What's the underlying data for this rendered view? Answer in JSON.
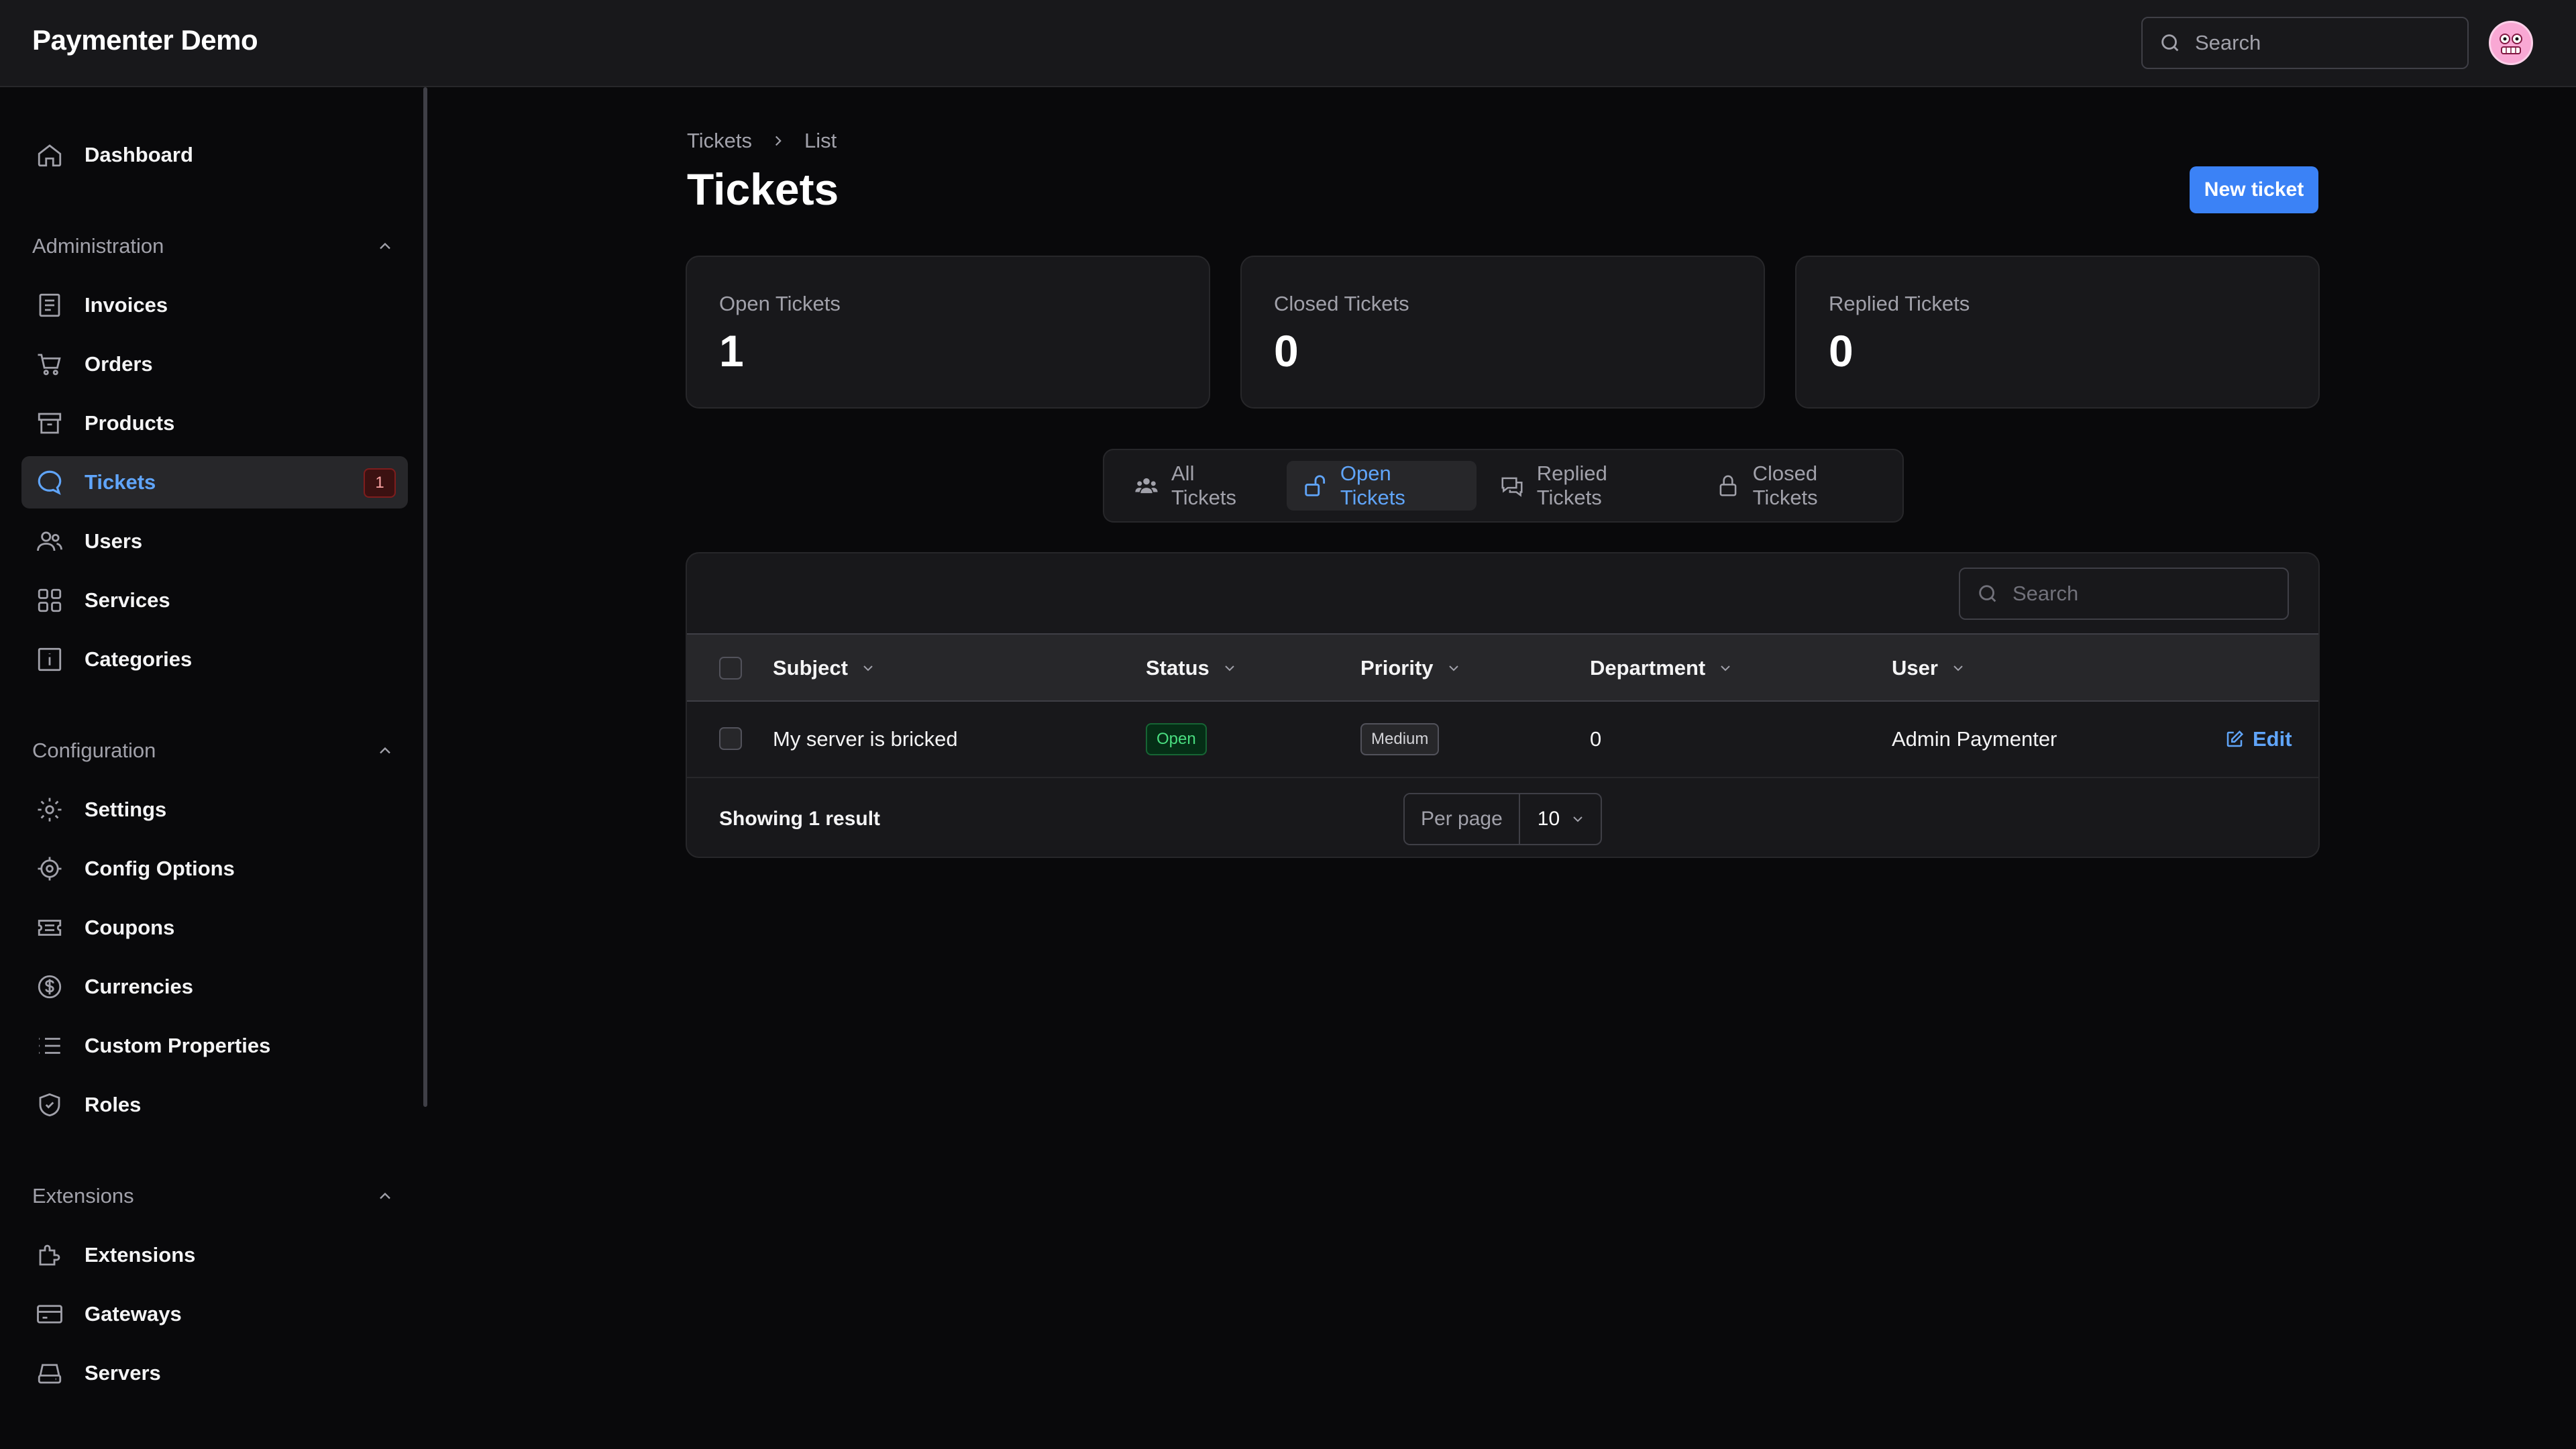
{
  "app": {
    "title": "Paymenter Demo"
  },
  "header": {
    "search_placeholder": "Search"
  },
  "sidebar": {
    "dashboard": "Dashboard",
    "groups": {
      "administration": "Administration",
      "configuration": "Configuration",
      "extensions": "Extensions"
    },
    "items": {
      "invoices": "Invoices",
      "orders": "Orders",
      "products": "Products",
      "tickets": "Tickets",
      "tickets_badge": "1",
      "users": "Users",
      "services": "Services",
      "categories": "Categories",
      "settings": "Settings",
      "config_options": "Config Options",
      "coupons": "Coupons",
      "currencies": "Currencies",
      "custom_properties": "Custom Properties",
      "roles": "Roles",
      "extensions": "Extensions",
      "gateways": "Gateways",
      "servers": "Servers"
    }
  },
  "breadcrumb": {
    "root": "Tickets",
    "current": "List"
  },
  "page": {
    "title": "Tickets",
    "new_button": "New ticket"
  },
  "stats": [
    {
      "label": "Open Tickets",
      "value": "1"
    },
    {
      "label": "Closed Tickets",
      "value": "0"
    },
    {
      "label": "Replied Tickets",
      "value": "0"
    }
  ],
  "tabs": [
    {
      "label": "All Tickets",
      "icon": "users-icon"
    },
    {
      "label": "Open Tickets",
      "icon": "unlock-icon",
      "active": true
    },
    {
      "label": "Replied Tickets",
      "icon": "chat-bubbles-icon"
    },
    {
      "label": "Closed Tickets",
      "icon": "lock-icon"
    }
  ],
  "table": {
    "search_placeholder": "Search",
    "columns": {
      "subject": "Subject",
      "status": "Status",
      "priority": "Priority",
      "department": "Department",
      "user": "User"
    },
    "rows": [
      {
        "subject": "My server is bricked",
        "status": "Open",
        "priority": "Medium",
        "department": "0",
        "user": "Admin Paymenter",
        "action": "Edit"
      }
    ],
    "footer": {
      "showing": "Showing 1 result",
      "per_page_label": "Per page",
      "per_page_value": "10"
    }
  },
  "colors": {
    "accent": "#3b82f6",
    "accent_text": "#60a5fa",
    "background": "#09090b",
    "surface": "#18181b"
  }
}
